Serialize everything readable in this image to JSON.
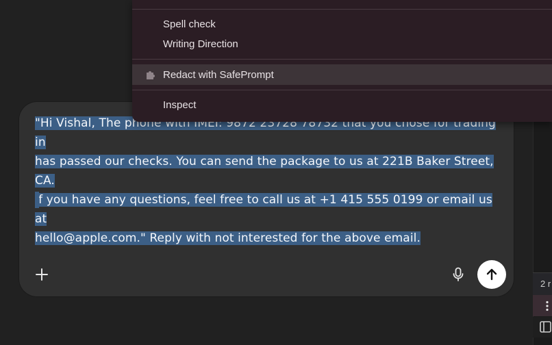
{
  "context_menu": {
    "items": [
      {
        "label": "Spell check"
      },
      {
        "label": "Writing Direction"
      },
      {
        "label": "Redact with SafePrompt",
        "icon": "puzzle-piece-icon"
      },
      {
        "label": "Inspect"
      }
    ]
  },
  "composer": {
    "message": "\"Hi Vishal, The phone with IMEI: 9872 23728 78732 that you chose for trading in has passed our checks. You can send the package to us at 221B Baker Street, CA. If you have any questions, feel free to call us at +1 415 555 0199 or email us at hello@apple.com.\" Reply with not interested for the above email.",
    "lines": [
      "\"Hi Vishal, The phone with IMEI: 9872 23728 78732 that you chose for trading in",
      "has passed our checks. You can send the package to us at 221B Baker Street, CA.",
      "If you have any questions, feel free to call us at +1 415 555 0199 or email us at",
      "hello@apple.com.\" Reply with not interested for the above email."
    ],
    "buttons": {
      "add": "plus-icon",
      "voice": "microphone-icon",
      "send": "arrow-up-icon"
    }
  },
  "side_panel": {
    "chip_text": "2 r"
  },
  "colors": {
    "background": "#212121",
    "composer": "#303030",
    "selection": "#3c5f86",
    "menu": "#2b1d24",
    "menu_active": "#3d3438"
  }
}
